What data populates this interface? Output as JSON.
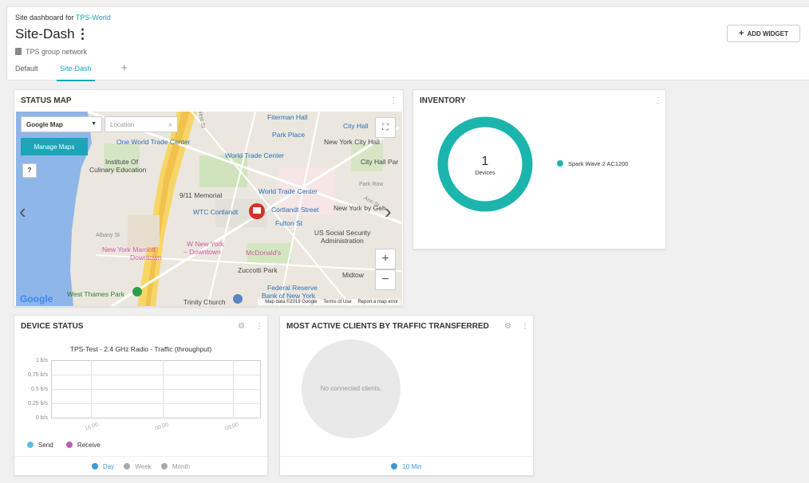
{
  "header": {
    "breadcrumb_prefix": "Site dashboard for",
    "breadcrumb_site": "TPS-World",
    "title": "Site-Dash",
    "title_menu": "⋮",
    "network": "TPS group network",
    "tabs": [
      {
        "label": "Default"
      },
      {
        "label": "Site-Dash"
      }
    ],
    "add_tab": "+",
    "add_widget": "ADD WIDGET"
  },
  "status_map": {
    "title": "STATUS MAP",
    "map_type": "Google Map",
    "location_placeholder": "Location",
    "manage_maps": "Manage Maps",
    "help": "?",
    "footer": [
      "Map data ©2019 Google",
      "Terms of Use",
      "Report a map error"
    ],
    "google": "Google",
    "labels": [
      "Fiterman Hall",
      "Park Place",
      "City Hall",
      "New York City Hall",
      "One World Trade Center",
      "World Trade Center",
      "Institute Of",
      "Culinary Education",
      "City Hall Par",
      "9/11 Memorial",
      "World Trade Center",
      "Park Row",
      "WTC Cortlandt",
      "Cortlandt Street",
      "New York by Geh",
      "Fulton St",
      "US Social Security",
      "Administration",
      "Albany St",
      "New York Marriott",
      "Downtown",
      "W New York",
      "– Downtown",
      "McDonald's",
      "Zuccotti Park",
      "Midtow",
      "Federal Reserve",
      "Bank of New York",
      "West Thames Park",
      "Trinity Church",
      "West St",
      "Ann St"
    ]
  },
  "inventory": {
    "title": "INVENTORY",
    "count": "1",
    "count_label": "Devices",
    "legend": "Spark Wave 2 AC1200",
    "color": "#1cb5ad"
  },
  "device_status": {
    "title": "DEVICE STATUS",
    "ranges": [
      "Day",
      "Week",
      "Month"
    ],
    "active_range": "Day"
  },
  "chart_data": {
    "type": "line",
    "title": "TPS-Test - 2.4 GHz Radio - Traffic (throughput)",
    "y_ticks": [
      "1 b/s",
      "0.75 b/s",
      "0.5 b/s",
      "0.25 b/s",
      "0 b/s"
    ],
    "x_ticks": [
      "16:00",
      "00:00",
      "08:00"
    ],
    "ylim": [
      0,
      1
    ],
    "series": [
      {
        "name": "Send",
        "color": "#5bc0de",
        "values": []
      },
      {
        "name": "Receive",
        "color": "#c45ab3",
        "values": []
      }
    ]
  },
  "most_active": {
    "title": "MOST ACTIVE CLIENTS BY TRAFFIC TRANSFERRED",
    "empty": "No connected clients.",
    "range": "10 Min"
  }
}
